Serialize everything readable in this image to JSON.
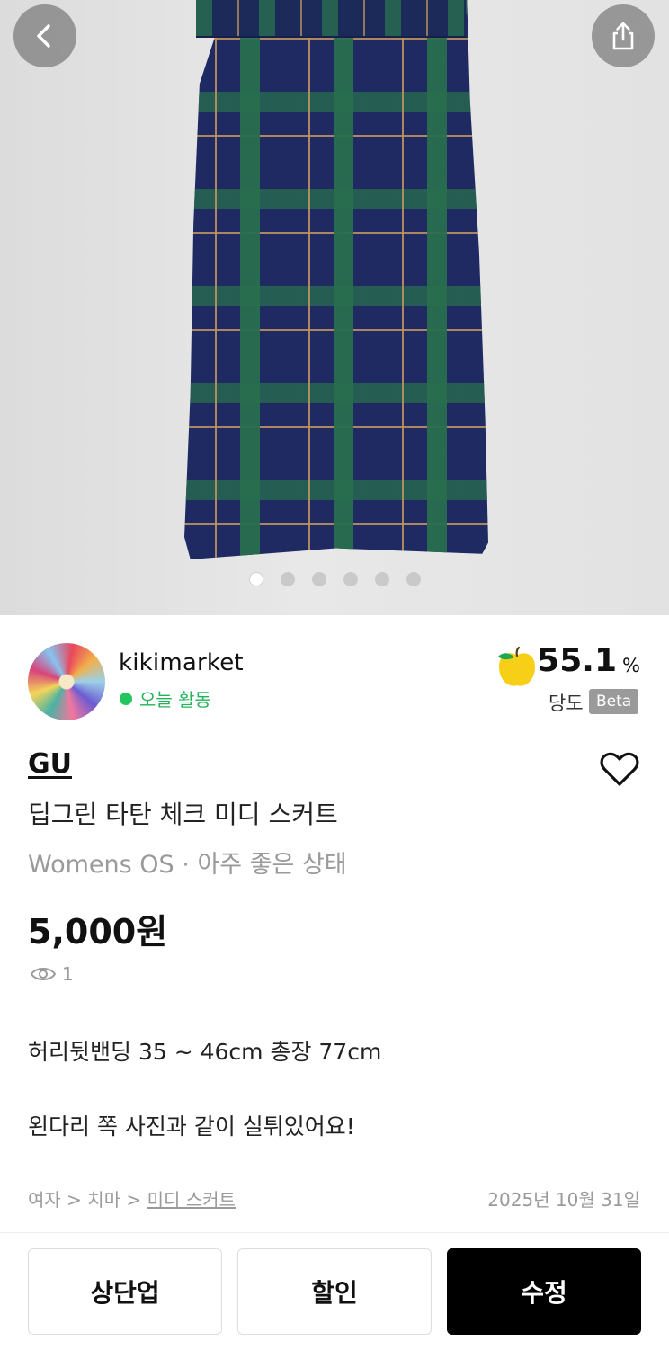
{
  "gallery": {
    "image_count": 6,
    "active_index": 0,
    "back_icon": "chevron-left-icon",
    "share_icon": "share-icon"
  },
  "seller": {
    "name": "kikimarket",
    "activity": "오늘 활동",
    "activity_color": "#22c55e",
    "sweetness": {
      "value": "55.1",
      "unit": "%",
      "label": "당도",
      "badge": "Beta",
      "icon": "apple-icon"
    }
  },
  "product": {
    "brand": "GU",
    "title": "딥그린 타탄 체크 미디 스커트",
    "meta": "Womens OS · 아주 좋은 상태",
    "price": "5,000원",
    "views": "1",
    "description": [
      "허리뒷밴딩 35 ~ 46cm 총장 77cm",
      "왼다리 쪽 사진과 같이 실튀있어요!"
    ]
  },
  "category": {
    "path": [
      "여자",
      "치마",
      "미디 스커트"
    ],
    "separator": ">"
  },
  "posted_date": "2025년 10월 31일",
  "actions": {
    "bump": "상단업",
    "discount": "할인",
    "edit": "수정"
  }
}
